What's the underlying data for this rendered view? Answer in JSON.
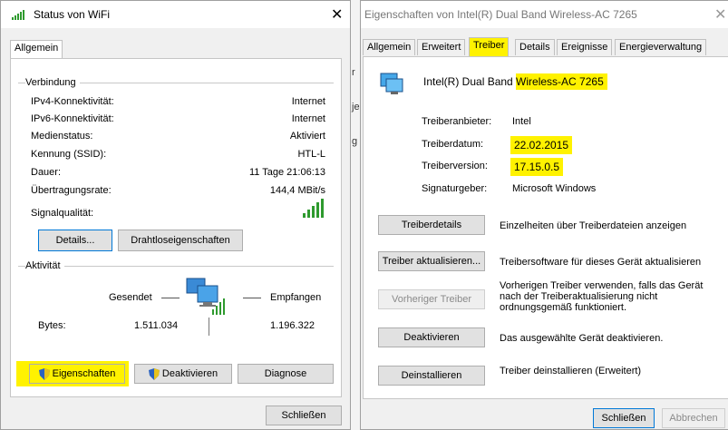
{
  "status": {
    "title": "Status von WiFi",
    "tab": "Allgemein",
    "connection_group": "Verbindung",
    "rows": [
      {
        "label": "IPv4-Konnektivität:",
        "value": "Internet"
      },
      {
        "label": "IPv6-Konnektivität:",
        "value": "Internet"
      },
      {
        "label": "Medienstatus:",
        "value": "Aktiviert"
      },
      {
        "label": "Kennung (SSID):",
        "value": "HTL-L"
      },
      {
        "label": "Dauer:",
        "value": "11 Tage 21:06:13"
      },
      {
        "label": "Übertragungsrate:",
        "value": "144,4 MBit/s"
      }
    ],
    "signal_label": "Signalqualität:",
    "details_button": "Details...",
    "wireless_props_button": "Drahtloseigenschaften",
    "activity_group": "Aktivität",
    "sent_label": "Gesendet",
    "received_label": "Empfangen",
    "bytes_label": "Bytes:",
    "bytes_sent": "1.511.034",
    "bytes_received": "1.196.322",
    "properties_button": "Eigenschaften",
    "deactivate_button": "Deaktivieren",
    "diagnose_button": "Diagnose",
    "close_button": "Schließen"
  },
  "props": {
    "title": "Eigenschaften von Intel(R) Dual Band Wireless-AC 7265",
    "tabs": [
      "Allgemein",
      "Erweitert",
      "Treiber",
      "Details",
      "Ereignisse",
      "Energieverwaltung"
    ],
    "active_tab": "Treiber",
    "device_name_a": "Intel(R) Dual Band ",
    "device_name_b": "Wireless-AC 7265",
    "info": [
      {
        "label": "Treiberanbieter:",
        "value": "Intel"
      },
      {
        "label": "Treiberdatum:",
        "value": "22.02.2015"
      },
      {
        "label": "Treiberversion:",
        "value": "17.15.0.5"
      },
      {
        "label": "Signaturgeber:",
        "value": "Microsoft Windows"
      }
    ],
    "actions": [
      {
        "button": "Treiberdetails",
        "desc": "Einzelheiten über Treiberdateien anzeigen",
        "enabled": true
      },
      {
        "button": "Treiber aktualisieren...",
        "desc": "Treibersoftware für dieses Gerät aktualisieren",
        "enabled": true
      },
      {
        "button": "Vorheriger Treiber",
        "desc": "Vorherigen Treiber verwenden, falls das Gerät nach der Treiberaktualisierung nicht ordnungsgemäß funktioniert.",
        "enabled": false
      },
      {
        "button": "Deaktivieren",
        "desc": "Das ausgewählte Gerät deaktivieren.",
        "enabled": true
      },
      {
        "button": "Deinstallieren",
        "desc": "Treiber deinstallieren (Erweitert)",
        "enabled": true
      }
    ],
    "close_button": "Schließen",
    "cancel_button": "Abbrechen"
  },
  "colors": {
    "highlight": "#fff200",
    "accent": "#0078d7",
    "signal": "#2e9a2e"
  },
  "icons": [
    "wifi-signal-icon",
    "close-icon",
    "signal-quality-icon",
    "network-activity-icon",
    "shield-icon",
    "network-adapter-icon"
  ]
}
